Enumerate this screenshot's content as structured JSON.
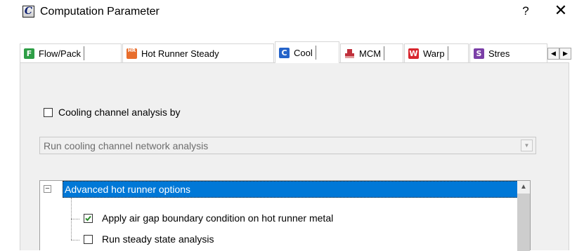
{
  "window": {
    "title": "Computation Parameter",
    "help_label": "?",
    "close_label": "✕",
    "app_icon_letter": "C"
  },
  "tabs": [
    {
      "label": "Flow/Pack",
      "icon_letter": "F",
      "icon_color": "#2e9e46",
      "active": false
    },
    {
      "label": "Hot Runner Steady",
      "icon_letter": "HR",
      "icon_color": "#e86d2c",
      "active": false
    },
    {
      "label": "Cool",
      "icon_letter": "C",
      "icon_color": "#2463c9",
      "active": true
    },
    {
      "label": "MCM",
      "icon_letter": "",
      "icon_color": "#c0303b",
      "active": false
    },
    {
      "label": "Warp",
      "icon_letter": "W",
      "icon_color": "#d8262e",
      "active": false
    },
    {
      "label": "Stres",
      "icon_letter": "S",
      "icon_color": "#7b3fa7",
      "active": false
    }
  ],
  "tab_scroll": {
    "left": "◀",
    "right": "▶"
  },
  "cooling_channel": {
    "checkbox_label": "Cooling channel analysis by",
    "checked": false,
    "dropdown_value": "Run cooling channel network analysis",
    "dropdown_arrow": "▼"
  },
  "tree": {
    "expander_symbol": "−",
    "root_label": "Advanced hot runner options",
    "items": [
      {
        "label": "Apply air gap boundary condition on hot runner metal",
        "checked": true
      },
      {
        "label": "Run steady state analysis",
        "checked": false
      }
    ],
    "scroll_up": "▲"
  },
  "colors": {
    "selection": "#0078d7",
    "panel_bg": "#f0f0f0",
    "check_green": "#2a8d2a"
  }
}
